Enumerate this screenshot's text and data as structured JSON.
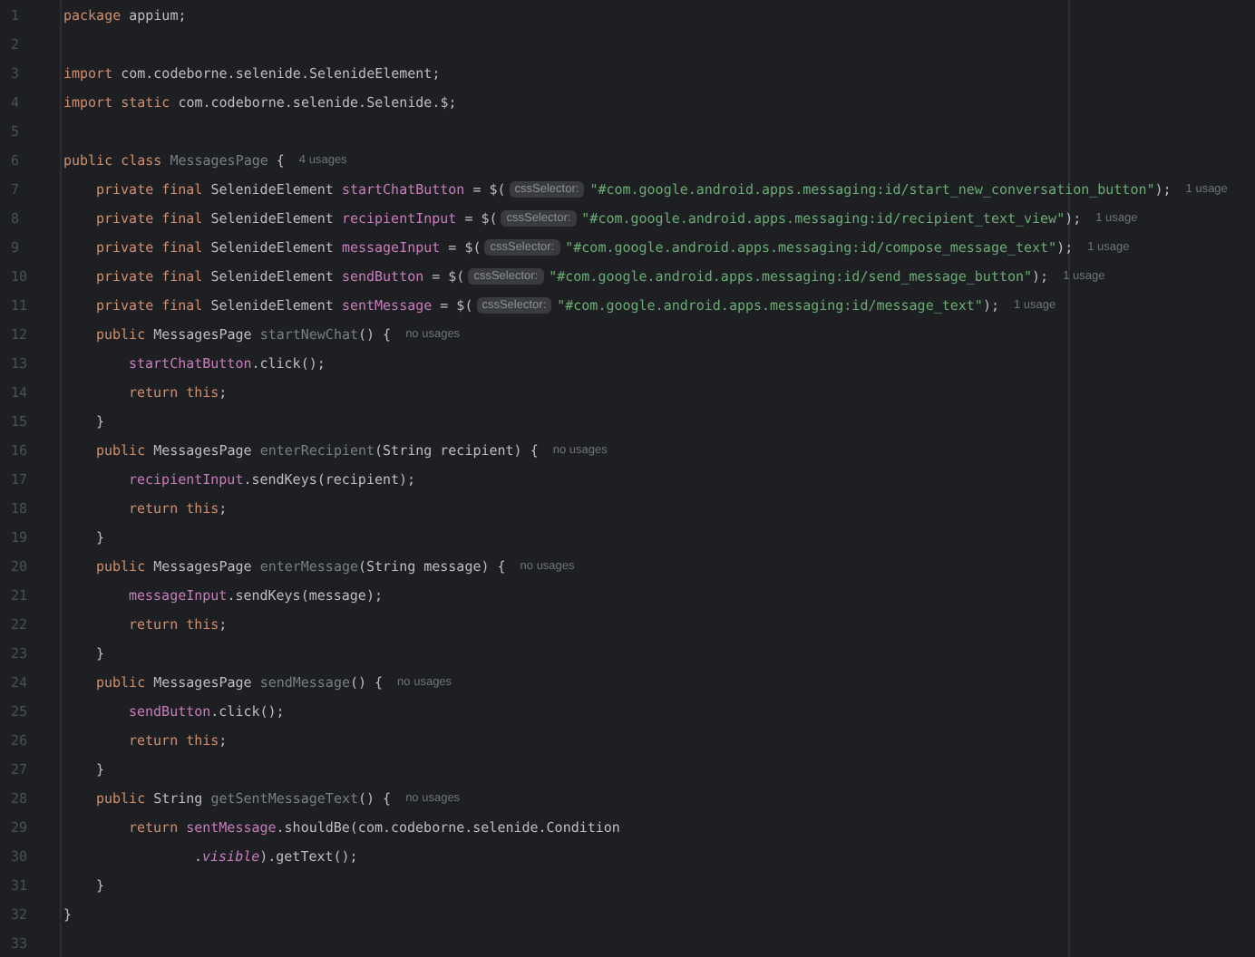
{
  "editor": {
    "lines": [
      {
        "number": "1",
        "tokens": [
          {
            "kind": "keyword",
            "text": "package"
          },
          {
            "kind": "plain",
            "text": " appium;"
          }
        ]
      },
      {
        "number": "2"
      },
      {
        "number": "3",
        "tokens": [
          {
            "kind": "keyword",
            "text": "import"
          },
          {
            "kind": "plain",
            "text": " com.codeborne.selenide.SelenideElement;"
          }
        ]
      },
      {
        "number": "4",
        "tokens": [
          {
            "kind": "keyword",
            "text": "import static"
          },
          {
            "kind": "plain",
            "text": " com.codeborne.selenide.Selenide.$;"
          }
        ]
      },
      {
        "number": "5"
      },
      {
        "number": "6",
        "tokens": [
          {
            "kind": "keyword",
            "text": "public class "
          },
          {
            "kind": "unused",
            "text": "MessagesPage"
          },
          {
            "kind": "plain",
            "text": " {"
          },
          {
            "kind": "usage",
            "text": "4 usages"
          }
        ],
        "children": [
          {
            "number": "7",
            "tokens": [
              {
                "kind": "keyword",
                "text": "private final"
              },
              {
                "kind": "plain",
                "text": " SelenideElement "
              },
              {
                "kind": "field",
                "text": "startChatButton"
              },
              {
                "kind": "plain",
                "text": " = $("
              },
              {
                "kind": "hint",
                "text": "cssSelector:"
              },
              {
                "kind": "string",
                "text": "\"#com.google.android.apps.messaging:id/start_new_conversation_button\""
              },
              {
                "kind": "plain",
                "text": ");"
              },
              {
                "kind": "usage",
                "text": "1 usage"
              }
            ]
          },
          {
            "number": "8",
            "tokens": [
              {
                "kind": "keyword",
                "text": "private final"
              },
              {
                "kind": "plain",
                "text": " SelenideElement "
              },
              {
                "kind": "field",
                "text": "recipientInput"
              },
              {
                "kind": "plain",
                "text": " = $("
              },
              {
                "kind": "hint",
                "text": "cssSelector:"
              },
              {
                "kind": "string",
                "text": "\"#com.google.android.apps.messaging:id/recipient_text_view\""
              },
              {
                "kind": "plain",
                "text": ");"
              },
              {
                "kind": "usage",
                "text": "1 usage"
              }
            ]
          },
          {
            "number": "9",
            "tokens": [
              {
                "kind": "keyword",
                "text": "private final"
              },
              {
                "kind": "plain",
                "text": " SelenideElement "
              },
              {
                "kind": "field",
                "text": "messageInput"
              },
              {
                "kind": "plain",
                "text": " = $("
              },
              {
                "kind": "hint",
                "text": "cssSelector:"
              },
              {
                "kind": "string",
                "text": "\"#com.google.android.apps.messaging:id/compose_message_text\""
              },
              {
                "kind": "plain",
                "text": ");"
              },
              {
                "kind": "usage",
                "text": "1 usage"
              }
            ]
          },
          {
            "number": "10",
            "tokens": [
              {
                "kind": "keyword",
                "text": "private final"
              },
              {
                "kind": "plain",
                "text": " SelenideElement "
              },
              {
                "kind": "field",
                "text": "sendButton"
              },
              {
                "kind": "plain",
                "text": " = $("
              },
              {
                "kind": "hint",
                "text": "cssSelector:"
              },
              {
                "kind": "string",
                "text": "\"#com.google.android.apps.messaging:id/send_message_button\""
              },
              {
                "kind": "plain",
                "text": ");"
              },
              {
                "kind": "usage",
                "text": "1 usage"
              }
            ]
          },
          {
            "number": "11",
            "tokens": [
              {
                "kind": "keyword",
                "text": "private final"
              },
              {
                "kind": "plain",
                "text": " SelenideElement "
              },
              {
                "kind": "field",
                "text": "sentMessage"
              },
              {
                "kind": "plain",
                "text": " = $("
              },
              {
                "kind": "hint",
                "text": "cssSelector:"
              },
              {
                "kind": "string",
                "text": "\"#com.google.android.apps.messaging:id/message_text\""
              },
              {
                "kind": "plain",
                "text": ");"
              },
              {
                "kind": "usage",
                "text": "1 usage"
              }
            ]
          },
          {
            "number": "12",
            "tokens": [
              {
                "kind": "keyword",
                "text": "public"
              },
              {
                "kind": "plain",
                "text": " MessagesPage "
              },
              {
                "kind": "unused",
                "text": "startNewChat"
              },
              {
                "kind": "plain",
                "text": "() {"
              },
              {
                "kind": "usage",
                "text": "no usages"
              }
            ],
            "children": [
              {
                "number": "13",
                "tokens": [
                  {
                    "kind": "field",
                    "text": "startChatButton"
                  },
                  {
                    "kind": "plain",
                    "text": ".click();"
                  }
                ]
              },
              {
                "number": "14",
                "tokens": [
                  {
                    "kind": "keyword",
                    "text": "return this"
                  },
                  {
                    "kind": "plain",
                    "text": ";"
                  }
                ]
              }
            ]
          },
          {
            "number": "15",
            "tokens": [
              {
                "kind": "plain",
                "text": "}"
              }
            ]
          },
          {
            "number": "16",
            "tokens": [
              {
                "kind": "keyword",
                "text": "public"
              },
              {
                "kind": "plain",
                "text": " MessagesPage "
              },
              {
                "kind": "unused",
                "text": "enterRecipient"
              },
              {
                "kind": "plain",
                "text": "(String recipient) {"
              },
              {
                "kind": "usage",
                "text": "no usages"
              }
            ],
            "children": [
              {
                "number": "17",
                "tokens": [
                  {
                    "kind": "field",
                    "text": "recipientInput"
                  },
                  {
                    "kind": "plain",
                    "text": ".sendKeys(recipient);"
                  }
                ]
              },
              {
                "number": "18",
                "tokens": [
                  {
                    "kind": "keyword",
                    "text": "return this"
                  },
                  {
                    "kind": "plain",
                    "text": ";"
                  }
                ]
              }
            ]
          },
          {
            "number": "19",
            "tokens": [
              {
                "kind": "plain",
                "text": "}"
              }
            ]
          },
          {
            "number": "20",
            "tokens": [
              {
                "kind": "keyword",
                "text": "public"
              },
              {
                "kind": "plain",
                "text": " MessagesPage "
              },
              {
                "kind": "unused",
                "text": "enterMessage"
              },
              {
                "kind": "plain",
                "text": "(String message) {"
              },
              {
                "kind": "usage",
                "text": "no usages"
              }
            ],
            "children": [
              {
                "number": "21",
                "tokens": [
                  {
                    "kind": "field",
                    "text": "messageInput"
                  },
                  {
                    "kind": "plain",
                    "text": ".sendKeys(message);"
                  }
                ]
              },
              {
                "number": "22",
                "tokens": [
                  {
                    "kind": "keyword",
                    "text": "return this"
                  },
                  {
                    "kind": "plain",
                    "text": ";"
                  }
                ]
              }
            ]
          },
          {
            "number": "23",
            "tokens": [
              {
                "kind": "plain",
                "text": "}"
              }
            ]
          },
          {
            "number": "24",
            "tokens": [
              {
                "kind": "keyword",
                "text": "public"
              },
              {
                "kind": "plain",
                "text": " MessagesPage "
              },
              {
                "kind": "unused",
                "text": "sendMessage"
              },
              {
                "kind": "plain",
                "text": "() {"
              },
              {
                "kind": "usage",
                "text": "no usages"
              }
            ],
            "children": [
              {
                "number": "25",
                "tokens": [
                  {
                    "kind": "field",
                    "text": "sendButton"
                  },
                  {
                    "kind": "plain",
                    "text": ".click();"
                  }
                ]
              },
              {
                "number": "26",
                "tokens": [
                  {
                    "kind": "keyword",
                    "text": "return this"
                  },
                  {
                    "kind": "plain",
                    "text": ";"
                  }
                ]
              }
            ]
          },
          {
            "number": "27",
            "tokens": [
              {
                "kind": "plain",
                "text": "}"
              }
            ]
          },
          {
            "number": "28",
            "tokens": [
              {
                "kind": "keyword",
                "text": "public"
              },
              {
                "kind": "plain",
                "text": " String "
              },
              {
                "kind": "unused",
                "text": "getSentMessageText"
              },
              {
                "kind": "plain",
                "text": "() {"
              },
              {
                "kind": "usage",
                "text": "no usages"
              }
            ],
            "children": [
              {
                "number": "29",
                "tokens": [
                  {
                    "kind": "keyword",
                    "text": "return "
                  },
                  {
                    "kind": "field",
                    "text": "sentMessage"
                  },
                  {
                    "kind": "plain",
                    "text": ".shouldBe(com.codeborne.selenide.Condition"
                  }
                ],
                "children": [
                  {
                    "number": "30",
                    "kind": "continuation",
                    "tokens": [
                      {
                        "kind": "plain",
                        "text": "."
                      },
                      {
                        "kind": "static",
                        "text": "visible"
                      },
                      {
                        "kind": "plain",
                        "text": ").getText();"
                      }
                    ]
                  }
                ]
              }
            ]
          },
          {
            "number": "31",
            "tokens": [
              {
                "kind": "plain",
                "text": "}"
              }
            ]
          }
        ]
      },
      {
        "number": "32",
        "tokens": [
          {
            "kind": "plain",
            "text": "}"
          }
        ]
      },
      {
        "number": "33"
      }
    ]
  }
}
